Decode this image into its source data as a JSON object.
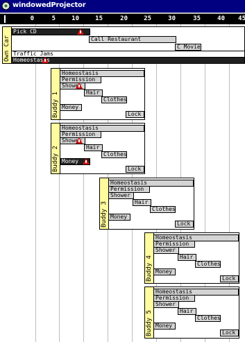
{
  "window": {
    "title": "windowedProjector"
  },
  "ruler": {
    "labels": [
      "0",
      "5",
      "10",
      "15",
      "20",
      "25",
      "30",
      "35",
      "40",
      "45"
    ]
  },
  "own_car": {
    "label": "Own Car",
    "tasks": [
      "Pick CD",
      "Call Restaurant",
      "C Movie",
      "Traffic Jams",
      "Homeostasis"
    ]
  },
  "buddies": [
    {
      "label": "Buddy 1",
      "tasks": [
        "Homeostasis",
        "Permission",
        "Shower",
        "Hair",
        "Clothes",
        "Money",
        "Lock"
      ]
    },
    {
      "label": "Buddy 2",
      "tasks": [
        "Homeostasis",
        "Permission",
        "Shower",
        "Hair",
        "Clothes",
        "Money",
        "Lock"
      ]
    },
    {
      "label": "Buddy 3",
      "tasks": [
        "Homeostasis",
        "Permission",
        "Shower",
        "Hair",
        "Clothes",
        "Money",
        "Lock"
      ]
    },
    {
      "label": "Buddy 4",
      "tasks": [
        "Homeostasis",
        "Permission",
        "Shower",
        "Hair",
        "Clothes",
        "Money",
        "Lock"
      ]
    },
    {
      "label": "Buddy 5",
      "tasks": [
        "Homeostasis",
        "Permission",
        "Shower",
        "Hair",
        "Clothes",
        "Money",
        "Lock"
      ]
    }
  ],
  "icons": {
    "app": "projector-icon",
    "warning": "warning-triangle-icon"
  },
  "colors": {
    "titlebar": "#000080",
    "label_strip": "#fffb9e",
    "warning": "#d21010"
  }
}
